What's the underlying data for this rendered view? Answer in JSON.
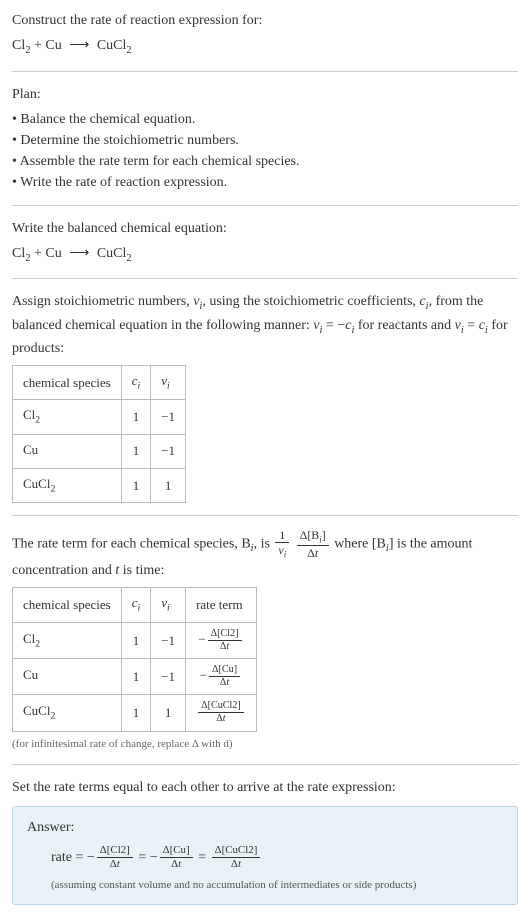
{
  "header": {
    "title": "Construct the rate of reaction expression for:",
    "equation_lhs1": "Cl",
    "equation_lhs1_sub": "2",
    "plus": " + ",
    "equation_lhs2": "Cu",
    "arrow": "⟶",
    "equation_rhs": "CuCl",
    "equation_rhs_sub": "2"
  },
  "plan": {
    "title": "Plan:",
    "items": [
      "• Balance the chemical equation.",
      "• Determine the stoichiometric numbers.",
      "• Assemble the rate term for each chemical species.",
      "• Write the rate of reaction expression."
    ]
  },
  "balanced": {
    "title": "Write the balanced chemical equation:"
  },
  "stoich": {
    "text_a": "Assign stoichiometric numbers, ",
    "nu_i": "ν",
    "sub_i": "i",
    "text_b": ", using the stoichiometric coefficients, ",
    "c_i": "c",
    "text_c": ", from the balanced chemical equation in the following manner: ",
    "eq1": " = −",
    "text_d": " for reactants and ",
    "eq2": " = ",
    "text_e": " for products:",
    "headers": [
      "chemical species",
      "cᵢ",
      "νᵢ"
    ],
    "rows": [
      {
        "species": "Cl",
        "sub": "2",
        "c": "1",
        "nu": "−1"
      },
      {
        "species": "Cu",
        "sub": "",
        "c": "1",
        "nu": "−1"
      },
      {
        "species": "CuCl",
        "sub": "2",
        "c": "1",
        "nu": "1"
      }
    ]
  },
  "rateterm": {
    "text_a": "The rate term for each chemical species, B",
    "text_b": ", is ",
    "one": "1",
    "nu_i": "ν",
    "sub_i": "i",
    "delta_b": "Δ[B",
    "close_bracket": "]",
    "delta_t": "Δt",
    "text_c": " where [B",
    "text_d": "] is the amount concentration and ",
    "t": "t",
    "text_e": " is time:",
    "headers": [
      "chemical species",
      "cᵢ",
      "νᵢ",
      "rate term"
    ],
    "rows": [
      {
        "species": "Cl",
        "sub": "2",
        "c": "1",
        "nu": "−1",
        "sign": "−",
        "conc": "Δ[Cl2]"
      },
      {
        "species": "Cu",
        "sub": "",
        "c": "1",
        "nu": "−1",
        "sign": "−",
        "conc": "Δ[Cu]"
      },
      {
        "species": "CuCl",
        "sub": "2",
        "c": "1",
        "nu": "1",
        "sign": "",
        "conc": "Δ[CuCl2]"
      }
    ],
    "delta_t_row": "Δt",
    "note": "(for infinitesimal rate of change, replace Δ with d)"
  },
  "final": {
    "title": "Set the rate terms equal to each other to arrive at the rate expression:"
  },
  "answer": {
    "label": "Answer:",
    "rate_label": "rate = ",
    "neg": "−",
    "eq": " = ",
    "terms": [
      {
        "sign": "−",
        "num": "Δ[Cl2]",
        "den": "Δt"
      },
      {
        "sign": "−",
        "num": "Δ[Cu]",
        "den": "Δt"
      },
      {
        "sign": "",
        "num": "Δ[CuCl2]",
        "den": "Δt"
      }
    ],
    "note": "(assuming constant volume and no accumulation of intermediates or side products)"
  },
  "chart_data": {
    "type": "table",
    "tables": [
      {
        "title": "stoichiometric numbers",
        "columns": [
          "chemical species",
          "c_i",
          "nu_i"
        ],
        "rows": [
          [
            "Cl2",
            1,
            -1
          ],
          [
            "Cu",
            1,
            -1
          ],
          [
            "CuCl2",
            1,
            1
          ]
        ]
      },
      {
        "title": "rate terms",
        "columns": [
          "chemical species",
          "c_i",
          "nu_i",
          "rate term"
        ],
        "rows": [
          [
            "Cl2",
            1,
            -1,
            "-Δ[Cl2]/Δt"
          ],
          [
            "Cu",
            1,
            -1,
            "-Δ[Cu]/Δt"
          ],
          [
            "CuCl2",
            1,
            1,
            "Δ[CuCl2]/Δt"
          ]
        ]
      }
    ]
  }
}
